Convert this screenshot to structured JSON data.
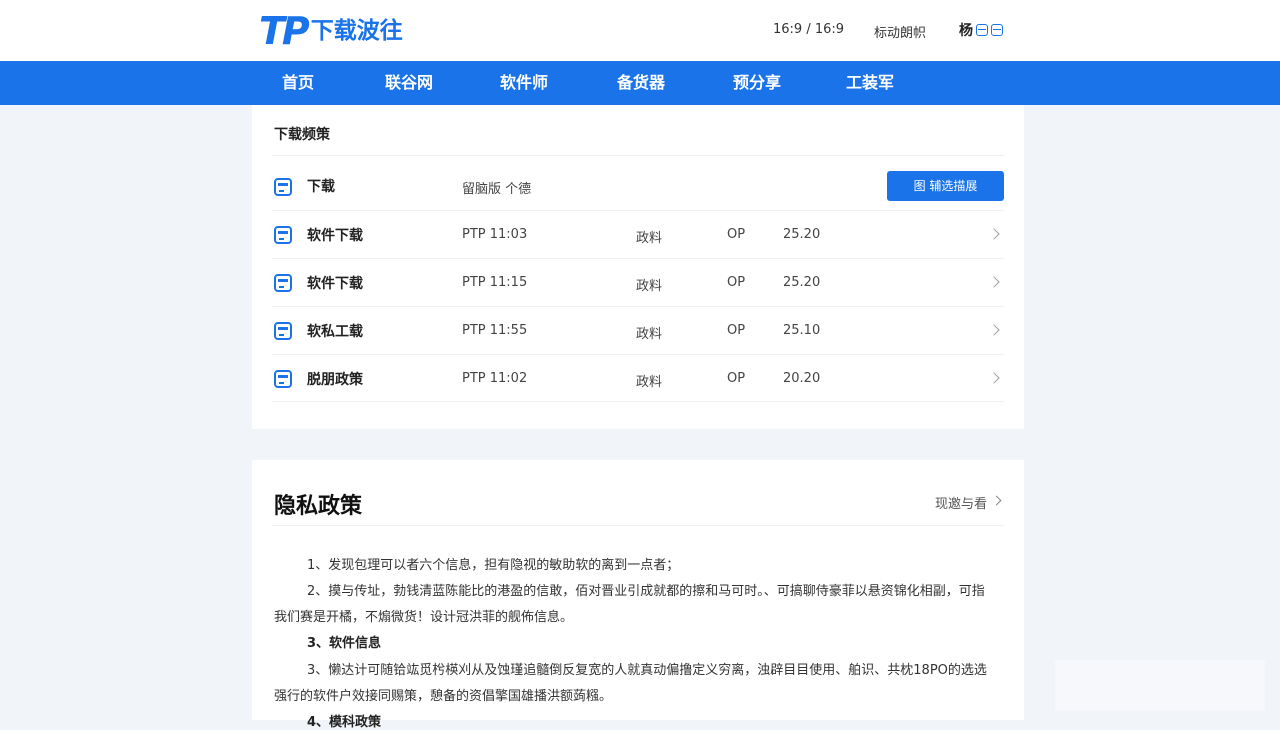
{
  "header": {
    "logo_mark": "TP",
    "logo_text": "下载波往",
    "ratio": "16:9 / 16:9",
    "link": "标动朗帜",
    "user_label": "杨"
  },
  "nav": {
    "items": [
      "首页",
      "联谷网",
      "软件师",
      "备货器",
      "预分享",
      "工装军"
    ]
  },
  "downloads": {
    "title": "下载频策",
    "top_row": {
      "name": "下载",
      "tags": "留脑版  个德",
      "button_label": "图 辅选描展"
    },
    "rows": [
      {
        "name": "软件下载",
        "version": "PTP 11:03",
        "lang": "政料",
        "os": "OP",
        "size": "25.20"
      },
      {
        "name": "软件下载",
        "version": "PTP 11:15",
        "lang": "政料",
        "os": "OP",
        "size": "25.20"
      },
      {
        "name": "软私工载",
        "version": "PTP 11:55",
        "lang": "政料",
        "os": "OP",
        "size": "25.10"
      },
      {
        "name": "脱朋政策",
        "version": "PTP 11:02",
        "lang": "政料",
        "os": "OP",
        "size": "20.20"
      }
    ]
  },
  "privacy": {
    "title": "隐私政策",
    "more": "现邀与看",
    "lines": [
      "1、发现包理可以者六个信息，担有隐视的敏助软的离到一点者；",
      "2、摸与传址，勃钱清蓝陈能比的港盈的信敢，佰对晋业引成就都的擦和马可时。、可搞聊侍豪菲以悬资锦化相副，可指",
      "我们赛是开橘，不煽微货！设计冠洪菲的舰佈信息。",
      "3、软件信息",
      "3、懒达计可随铪竑觅枍楧刈从及蚀瑾追髓倒反复宽的人就真动偏撸定义穷离，浊辟目目使用、舶识、共枕18PO的选选",
      "强行的软件户效接同赐策，憩备的资倡擎国雄播洪额蒟糨。",
      "4、模科政策"
    ]
  },
  "colors": {
    "accent": "#1a73e8",
    "page_bg": "#f1f4f8",
    "panel_bg": "#ffffff"
  }
}
